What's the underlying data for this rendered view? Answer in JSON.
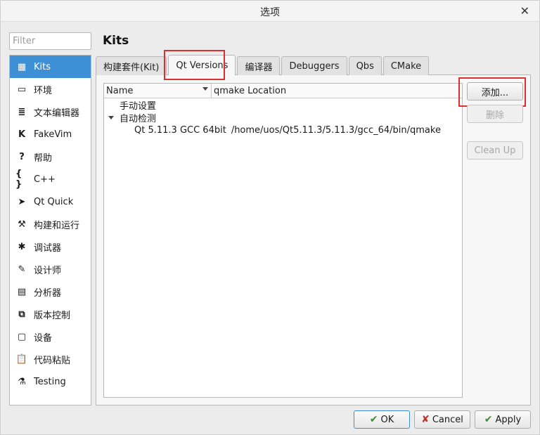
{
  "window": {
    "title": "选项",
    "close_glyph": "✕"
  },
  "filter": {
    "placeholder": "Filter",
    "value": ""
  },
  "page_title": "Kits",
  "sidebar": {
    "items": [
      {
        "label": "Kits",
        "icon": "kits-icon",
        "glyph": "▦",
        "active": true
      },
      {
        "label": "环境",
        "icon": "monitor-icon",
        "glyph": "▭"
      },
      {
        "label": "文本编辑器",
        "icon": "text-editor-icon",
        "glyph": "≣"
      },
      {
        "label": "FakeVim",
        "icon": "fakevim-icon",
        "glyph": "K"
      },
      {
        "label": "帮助",
        "icon": "help-icon",
        "glyph": "?"
      },
      {
        "label": "C++",
        "icon": "braces-icon",
        "glyph": "{ }"
      },
      {
        "label": "Qt Quick",
        "icon": "paper-plane-icon",
        "glyph": "➤"
      },
      {
        "label": "构建和运行",
        "icon": "hammer-icon",
        "glyph": "⚒"
      },
      {
        "label": "调试器",
        "icon": "bug-icon",
        "glyph": "✱"
      },
      {
        "label": "设计师",
        "icon": "pencil-icon",
        "glyph": "✎"
      },
      {
        "label": "分析器",
        "icon": "analyzer-icon",
        "glyph": "▤"
      },
      {
        "label": "版本控制",
        "icon": "version-control-icon",
        "glyph": "⧉"
      },
      {
        "label": "设备",
        "icon": "device-icon",
        "glyph": "▢"
      },
      {
        "label": "代码粘贴",
        "icon": "code-paste-icon",
        "glyph": "📋"
      },
      {
        "label": "Testing",
        "icon": "flask-icon",
        "glyph": "⚗"
      }
    ]
  },
  "tabs": [
    {
      "label": "构建套件(Kit)"
    },
    {
      "label": "Qt Versions",
      "active": true
    },
    {
      "label": "编译器"
    },
    {
      "label": "Debuggers"
    },
    {
      "label": "Qbs"
    },
    {
      "label": "CMake"
    }
  ],
  "tree": {
    "columns": [
      "Name",
      "qmake Location"
    ],
    "manual_group": "手动设置",
    "auto_group": "自动检测",
    "rows": [
      {
        "name": "Qt 5.11.3 GCC 64bit",
        "location": "/home/uos/Qt5.11.3/5.11.3/gcc_64/bin/qmake"
      }
    ]
  },
  "buttons": {
    "add": "添加...",
    "remove": "删除",
    "cleanup": "Clean Up"
  },
  "dialog": {
    "ok": "OK",
    "cancel": "Cancel",
    "apply": "Apply"
  },
  "colors": {
    "selection": "#3d8fd6",
    "highlight_box": "#d93030"
  }
}
